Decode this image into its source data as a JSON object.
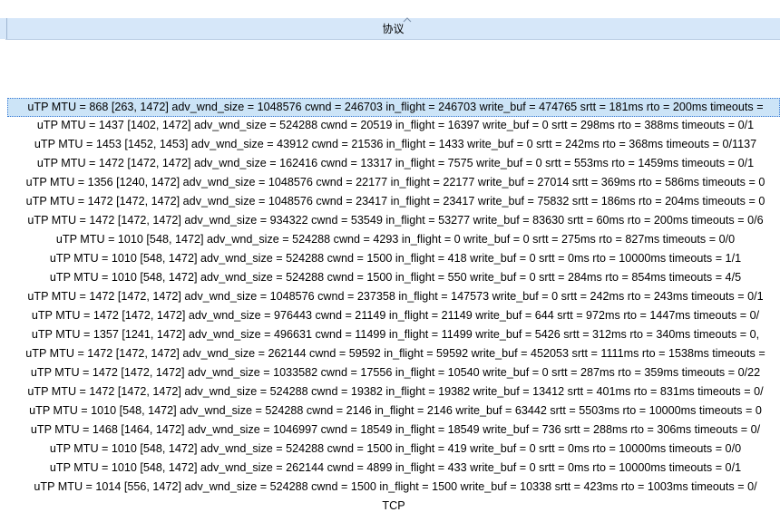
{
  "column": {
    "header": "协议"
  },
  "rows": [
    "uTP MTU = 868 [263, 1472] adv_wnd_size = 1048576 cwnd = 246703 in_flight = 246703 write_buf = 474765 srtt = 181ms rto = 200ms timeouts =",
    "uTP MTU = 1437 [1402, 1472] adv_wnd_size = 524288 cwnd = 20519 in_flight = 16397 write_buf = 0 srtt = 298ms rto = 388ms timeouts = 0/1",
    "uTP MTU = 1453 [1452, 1453] adv_wnd_size = 43912 cwnd = 21536 in_flight = 1433 write_buf = 0 srtt = 242ms rto = 368ms timeouts = 0/1137",
    "uTP MTU = 1472 [1472, 1472] adv_wnd_size = 162416 cwnd = 13317 in_flight = 7575 write_buf = 0 srtt = 553ms rto = 1459ms timeouts = 0/1",
    "uTP MTU = 1356 [1240, 1472] adv_wnd_size = 1048576 cwnd = 22177 in_flight = 22177 write_buf = 27014 srtt = 369ms rto = 586ms timeouts = 0",
    "uTP MTU = 1472 [1472, 1472] adv_wnd_size = 1048576 cwnd = 23417 in_flight = 23417 write_buf = 75832 srtt = 186ms rto = 204ms timeouts = 0",
    "uTP MTU = 1472 [1472, 1472] adv_wnd_size = 934322 cwnd = 53549 in_flight = 53277 write_buf = 83630 srtt = 60ms rto = 200ms timeouts = 0/6",
    "uTP MTU = 1010 [548, 1472] adv_wnd_size = 524288 cwnd = 4293 in_flight = 0 write_buf = 0 srtt = 275ms rto = 827ms timeouts = 0/0",
    "uTP MTU = 1010 [548, 1472] adv_wnd_size = 524288 cwnd = 1500 in_flight = 418 write_buf = 0 srtt = 0ms rto = 10000ms timeouts = 1/1",
    "uTP MTU = 1010 [548, 1472] adv_wnd_size = 524288 cwnd = 1500 in_flight = 550 write_buf = 0 srtt = 284ms rto = 854ms timeouts = 4/5",
    "uTP MTU = 1472 [1472, 1472] adv_wnd_size = 1048576 cwnd = 237358 in_flight = 147573 write_buf = 0 srtt = 242ms rto = 243ms timeouts = 0/1",
    "uTP MTU = 1472 [1472, 1472] adv_wnd_size = 976443 cwnd = 21149 in_flight = 21149 write_buf = 644 srtt = 972ms rto = 1447ms timeouts = 0/",
    "uTP MTU = 1357 [1241, 1472] adv_wnd_size = 496631 cwnd = 11499 in_flight = 11499 write_buf = 5426 srtt = 312ms rto = 340ms timeouts = 0,",
    "uTP MTU = 1472 [1472, 1472] adv_wnd_size = 262144 cwnd = 59592 in_flight = 59592 write_buf = 452053 srtt = 1111ms rto = 1538ms timeouts =",
    "uTP MTU = 1472 [1472, 1472] adv_wnd_size = 1033582 cwnd = 17556 in_flight = 10540 write_buf = 0 srtt = 287ms rto = 359ms timeouts = 0/22",
    "uTP MTU = 1472 [1472, 1472] adv_wnd_size = 524288 cwnd = 19382 in_flight = 19382 write_buf = 13412 srtt = 401ms rto = 831ms timeouts = 0/",
    "uTP MTU = 1010 [548, 1472] adv_wnd_size = 524288 cwnd = 2146 in_flight = 2146 write_buf = 63442 srtt = 5503ms rto = 10000ms timeouts = 0",
    "uTP MTU = 1468 [1464, 1472] adv_wnd_size = 1046997 cwnd = 18549 in_flight = 18549 write_buf = 736 srtt = 288ms rto = 306ms timeouts = 0/",
    "uTP MTU = 1010 [548, 1472] adv_wnd_size = 524288 cwnd = 1500 in_flight = 419 write_buf = 0 srtt = 0ms rto = 10000ms timeouts = 0/0",
    "uTP MTU = 1010 [548, 1472] adv_wnd_size = 262144 cwnd = 4899 in_flight = 433 write_buf = 0 srtt = 0ms rto = 10000ms timeouts = 0/1",
    "uTP MTU = 1014 [556, 1472] adv_wnd_size = 524288 cwnd = 1500 in_flight = 1500 write_buf = 10338 srtt = 423ms rto = 1003ms timeouts = 0/",
    "TCP"
  ],
  "selected_index": 0
}
